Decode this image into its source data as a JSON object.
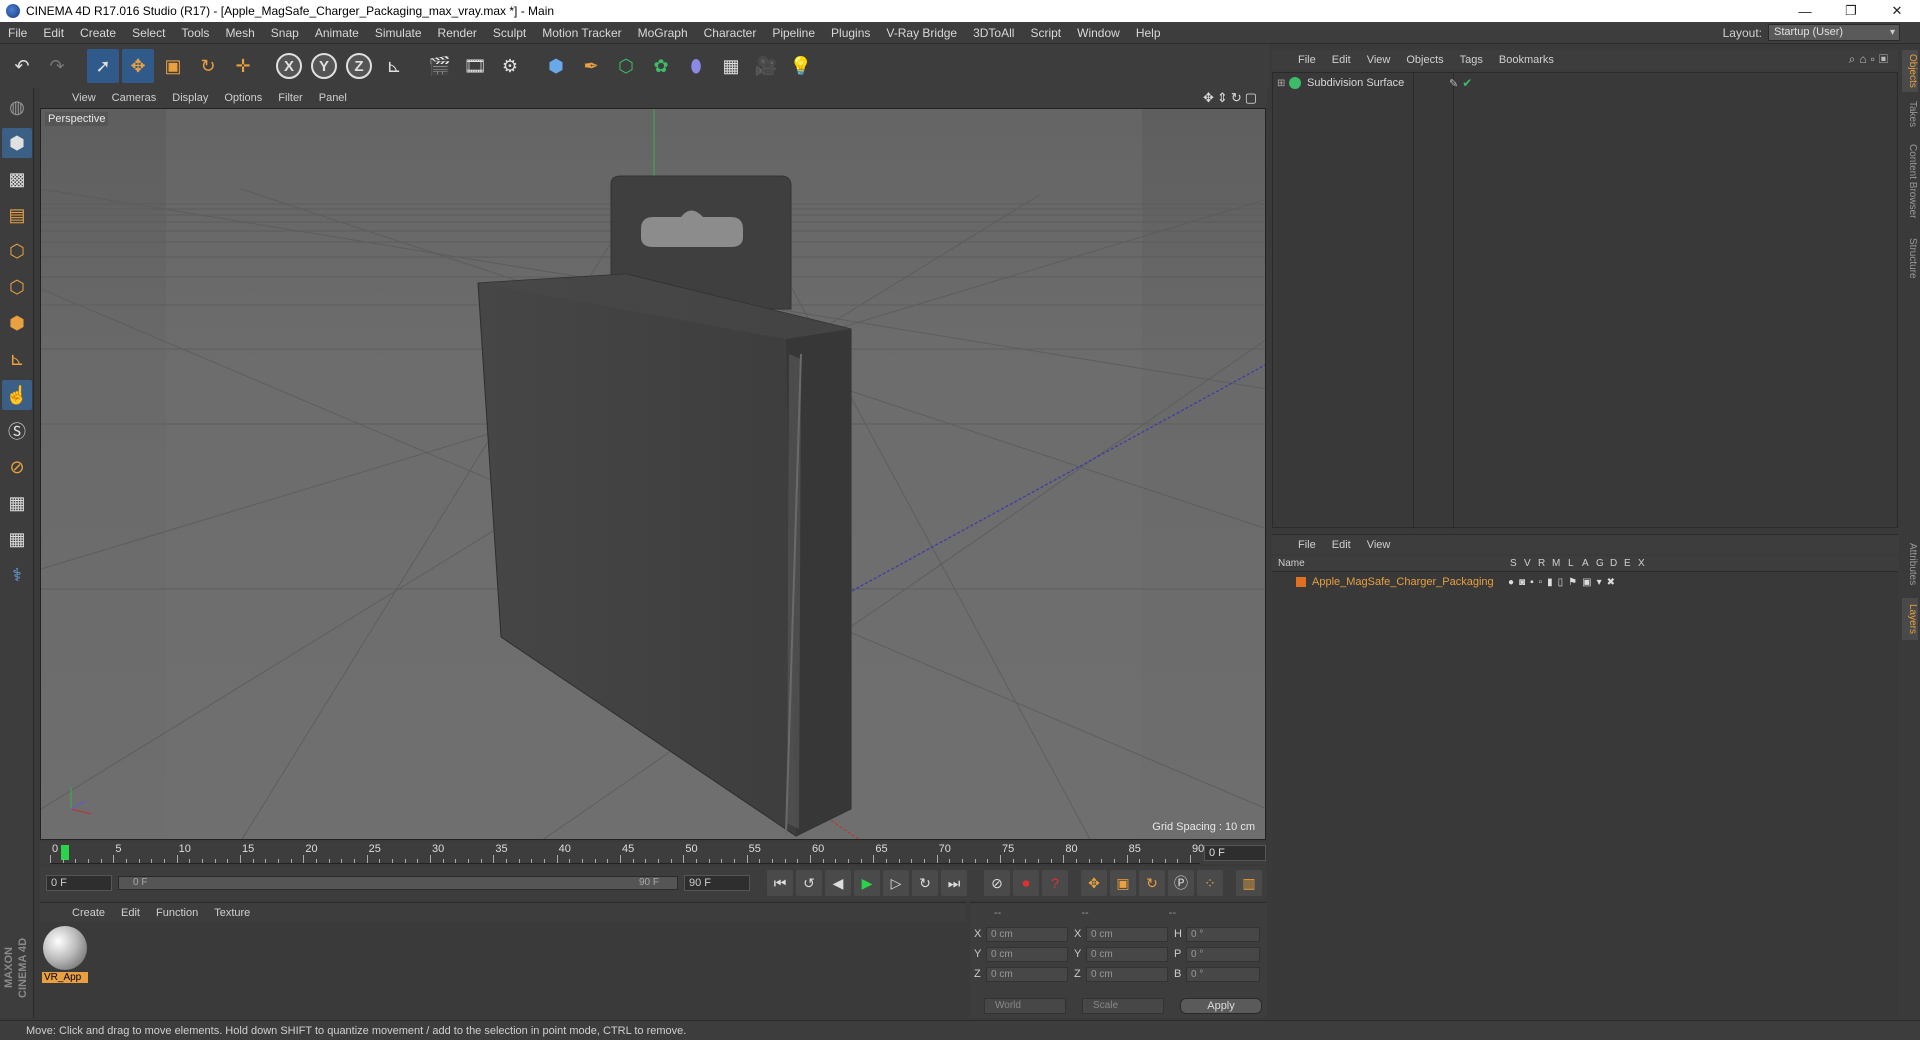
{
  "window": {
    "title": "CINEMA 4D R17.016 Studio (R17) - [Apple_MagSafe_Charger_Packaging_max_vray.max *] - Main",
    "minimize": "—",
    "maximize": "❐",
    "close": "✕"
  },
  "menubar": {
    "items": [
      "File",
      "Edit",
      "Create",
      "Select",
      "Tools",
      "Mesh",
      "Snap",
      "Animate",
      "Simulate",
      "Render",
      "Sculpt",
      "Motion Tracker",
      "MoGraph",
      "Character",
      "Pipeline",
      "Plugins",
      "V-Ray Bridge",
      "3DToAll",
      "Script",
      "Window",
      "Help"
    ],
    "layout_label": "Layout:",
    "layout_value": "Startup (User)"
  },
  "toolbar": {
    "icons": [
      "undo-icon",
      "redo-icon",
      "select-icon",
      "move-icon",
      "scale-icon",
      "rotate-icon",
      "live-select-icon",
      "x-axis-lock",
      "y-axis-lock",
      "z-axis-lock",
      "world-coordinates-icon",
      "render-view-icon",
      "render-picture-viewer-icon",
      "render-settings-icon",
      "cube-icon",
      "pen-icon",
      "subdivision-icon",
      "cloner-icon",
      "deformer-icon",
      "floor-icon",
      "camera-icon",
      "light-icon"
    ],
    "axis_x": "X",
    "axis_y": "Y",
    "axis_z": "Z"
  },
  "viewport": {
    "menu": [
      "View",
      "Cameras",
      "Display",
      "Options",
      "Filter",
      "Panel"
    ],
    "label": "Perspective",
    "grid_spacing": "Grid Spacing : 10 cm"
  },
  "timeline": {
    "ticks": [
      "0",
      "5",
      "10",
      "15",
      "20",
      "25",
      "30",
      "35",
      "40",
      "45",
      "50",
      "55",
      "60",
      "65",
      "70",
      "75",
      "80",
      "85",
      "90"
    ],
    "current_frame": "0 F"
  },
  "playback": {
    "start_field": "0 F",
    "range_left": "0 F",
    "range_right": "90 F",
    "end_field": "90 F"
  },
  "material_manager": {
    "menu": [
      "Create",
      "Edit",
      "Function",
      "Texture"
    ],
    "material_name": "VR_App"
  },
  "coordinates": {
    "headers": [
      "--",
      "--",
      "--"
    ],
    "rows": [
      {
        "a": "X",
        "av": "0 cm",
        "b": "X",
        "bv": "0 cm",
        "c": "H",
        "cv": "0 °"
      },
      {
        "a": "Y",
        "av": "0 cm",
        "b": "Y",
        "bv": "0 cm",
        "c": "P",
        "cv": "0 °"
      },
      {
        "a": "Z",
        "av": "0 cm",
        "b": "Z",
        "bv": "0 cm",
        "c": "B",
        "cv": "0 °"
      }
    ],
    "mode1": "World",
    "mode2": "Scale",
    "apply": "Apply"
  },
  "object_manager": {
    "menu": [
      "File",
      "Edit",
      "View",
      "Objects",
      "Tags",
      "Bookmarks"
    ],
    "objects": [
      {
        "name": "Subdivision Surface"
      }
    ]
  },
  "layer_manager": {
    "menu": [
      "File",
      "Edit",
      "View"
    ],
    "headers": [
      "Name",
      "S",
      "V",
      "R",
      "M",
      "L",
      "A",
      "G",
      "D",
      "E",
      "X"
    ],
    "layers": [
      {
        "name": "Apple_MagSafe_Charger_Packaging",
        "color": "#e07020"
      }
    ]
  },
  "right_tabs": [
    "Objects",
    "Takes",
    "Content Browser",
    "Structure",
    "Attributes",
    "Layers"
  ],
  "branding": {
    "maxon": "MAXON",
    "cinema": "CINEMA 4D"
  },
  "status": "Move: Click and drag to move elements. Hold down SHIFT to quantize movement / add to the selection in point mode, CTRL to remove."
}
